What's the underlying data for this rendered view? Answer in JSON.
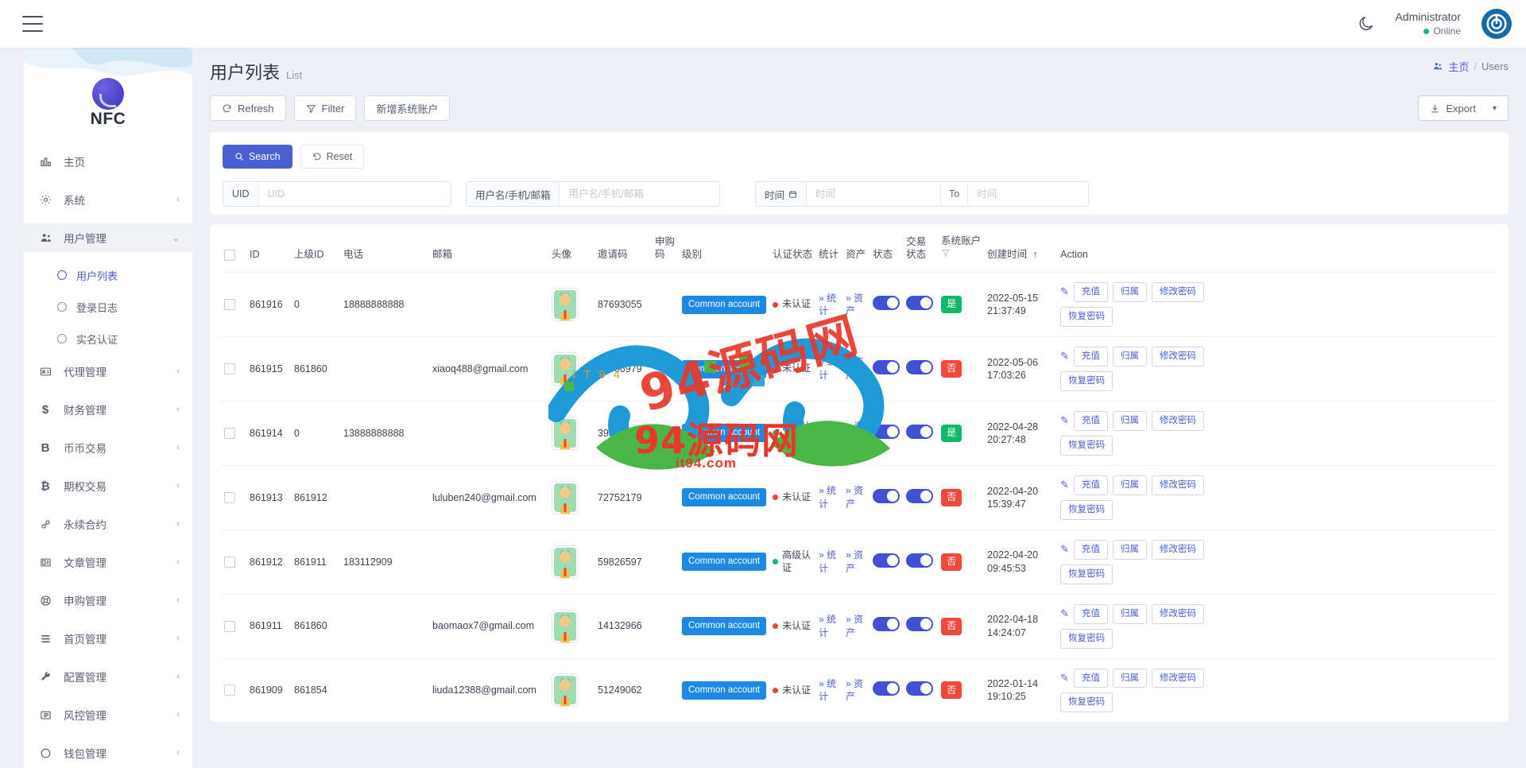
{
  "topbar": {
    "menu_icon": "hamburger-icon",
    "theme_icon": "moon-icon",
    "user_name": "Administrator",
    "user_status": "Online"
  },
  "sidebar": {
    "brand": "NFC",
    "items": [
      {
        "label": "主页",
        "icon": "chart-bar-icon",
        "arrow": "",
        "active": false
      },
      {
        "label": "系统",
        "icon": "gear-icon",
        "arrow": "‹",
        "active": false
      },
      {
        "label": "用户管理",
        "icon": "users-icon",
        "arrow": "⌄",
        "active": true
      },
      {
        "label": "代理管理",
        "icon": "id-card-icon",
        "arrow": "‹",
        "active": false
      },
      {
        "label": "财务管理",
        "icon": "dollar-icon",
        "arrow": "‹",
        "active": false
      },
      {
        "label": "币币交易",
        "icon": "b-letter-icon",
        "arrow": "‹",
        "active": false
      },
      {
        "label": "期权交易",
        "icon": "bitcoin-icon",
        "arrow": "‹",
        "active": false
      },
      {
        "label": "永续合约",
        "icon": "link-icon",
        "arrow": "‹",
        "active": false
      },
      {
        "label": "文章管理",
        "icon": "article-icon",
        "arrow": "‹",
        "active": false
      },
      {
        "label": "申购管理",
        "icon": "lifebuoy-icon",
        "arrow": "‹",
        "active": false
      },
      {
        "label": "首页管理",
        "icon": "lines-icon",
        "arrow": "‹",
        "active": false
      },
      {
        "label": "配置管理",
        "icon": "wrench-icon",
        "arrow": "‹",
        "active": false
      },
      {
        "label": "风控管理",
        "icon": "list-icon",
        "arrow": "‹",
        "active": false
      },
      {
        "label": "钱包管理",
        "icon": "circle-icon",
        "arrow": "‹",
        "active": false
      }
    ],
    "submenu": [
      {
        "label": "用户列表",
        "selected": true
      },
      {
        "label": "登录日志",
        "selected": false
      },
      {
        "label": "实名认证",
        "selected": false
      }
    ]
  },
  "page": {
    "title": "用户列表",
    "subtitle": "List",
    "breadcrumb_home": "主页",
    "breadcrumb_current": "Users"
  },
  "toolbar": {
    "refresh": "Refresh",
    "filter": "Filter",
    "add_account": "新增系统账户",
    "export": "Export"
  },
  "search": {
    "search_btn": "Search",
    "reset_btn": "Reset",
    "uid_label": "UID",
    "uid_placeholder": "UID",
    "user_label": "用户名/手机/邮箱",
    "user_placeholder": "用户名/手机/邮箱",
    "time_label": "时间",
    "time_placeholder": "时间",
    "time_to": "To",
    "time_to_placeholder": "时间"
  },
  "table": {
    "headers": {
      "id": "ID",
      "parent_id": "上级ID",
      "phone": "电话",
      "email": "邮箱",
      "avatar": "头像",
      "invite_code": "邀请码",
      "subscribe_code": "申购码",
      "level": "级别",
      "cert_status": "认证状态",
      "stats": "统计",
      "assets": "资产",
      "status": "状态",
      "trade_status": "交易状态",
      "sys_account": "系统账户",
      "create_time": "创建时间",
      "action": "Action"
    },
    "cell_labels": {
      "stats": "统计",
      "assets": "资产",
      "recharge": "充值",
      "belong": "归属",
      "change_pwd": "修改密码",
      "restore_pwd": "恢复密码"
    },
    "rows": [
      {
        "id": "861916",
        "parent_id": "0",
        "phone": "18888888888",
        "email": "",
        "invite_code": "87693055",
        "subscribe_code": "",
        "level": "Common account",
        "cert": "未认证",
        "cert_ok": false,
        "status_on": true,
        "trade_on": true,
        "sys": "是",
        "sys_yes": true,
        "created": "2022-05-15 21:37:49"
      },
      {
        "id": "861915",
        "parent_id": "861860",
        "phone": "",
        "email": "xiaoq488@gmail.com",
        "invite_code": "14506979",
        "subscribe_code": "",
        "level": "Common account",
        "cert": "未认证",
        "cert_ok": false,
        "status_on": true,
        "trade_on": true,
        "sys": "否",
        "sys_yes": false,
        "created": "2022-05-06 17:03:26"
      },
      {
        "id": "861914",
        "parent_id": "0",
        "phone": "13888888888",
        "email": "",
        "invite_code": "39347165",
        "subscribe_code": "",
        "level": "Common account",
        "cert": "高级认证",
        "cert_ok": true,
        "status_on": true,
        "trade_on": true,
        "sys": "是",
        "sys_yes": true,
        "created": "2022-04-28 20:27:48"
      },
      {
        "id": "861913",
        "parent_id": "861912",
        "phone": "",
        "email": "luluben240@gmail.com",
        "invite_code": "72752179",
        "subscribe_code": "",
        "level": "Common account",
        "cert": "未认证",
        "cert_ok": false,
        "status_on": true,
        "trade_on": true,
        "sys": "否",
        "sys_yes": false,
        "created": "2022-04-20 15:39:47"
      },
      {
        "id": "861912",
        "parent_id": "861911",
        "phone": "183112909",
        "email": "",
        "invite_code": "59826597",
        "subscribe_code": "",
        "level": "Common account",
        "cert": "高级认证",
        "cert_ok": true,
        "status_on": true,
        "trade_on": true,
        "sys": "否",
        "sys_yes": false,
        "created": "2022-04-20 09:45:53"
      },
      {
        "id": "861911",
        "parent_id": "861860",
        "phone": "",
        "email": "baomaox7@gmail.com",
        "invite_code": "14132966",
        "subscribe_code": "",
        "level": "Common account",
        "cert": "未认证",
        "cert_ok": false,
        "status_on": true,
        "trade_on": true,
        "sys": "否",
        "sys_yes": false,
        "created": "2022-04-18 14:24:07"
      },
      {
        "id": "861909",
        "parent_id": "861854",
        "phone": "",
        "email": "liuda12388@gmail.com",
        "invite_code": "51249062",
        "subscribe_code": "",
        "level": "Common account",
        "cert": "未认证",
        "cert_ok": false,
        "status_on": true,
        "trade_on": true,
        "sys": "否",
        "sys_yes": false,
        "created": "2022-01-14 19:10:25"
      }
    ]
  },
  "watermark": {
    "line1": "94源码网",
    "line2": "94源码网",
    "sub": "it94.com",
    "it": "IT94"
  },
  "colors": {
    "accent": "#4b5fd4",
    "tag_blue": "#1e88e5",
    "green": "#14b866",
    "red": "#f0483a",
    "bg": "#eef0f6"
  }
}
